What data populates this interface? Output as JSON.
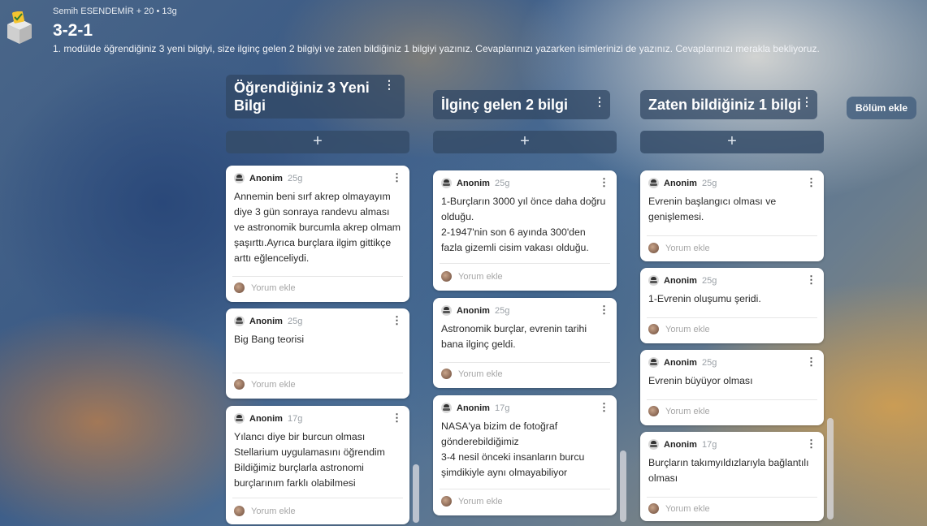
{
  "header": {
    "meta": "Semih ESENDEMİR + 20 • 13g",
    "title": "3-2-1",
    "description": "1. modülde öğrendiğiniz 3 yeni bilgiyi, size ilginç gelen 2 bilgiyi ve zaten bildiğiniz 1 bilgiyi yazınız. Cevaplarınızı yazarken isimlerinizi de yazınız. Cevaplarınızı merakla bekliyoruz."
  },
  "add_symbol": "+",
  "menu_symbol": "⋮",
  "add_section_label": "Bölüm ekle",
  "icons": {
    "app": "ballot-box-icon",
    "author": "anonymous-spy-icon",
    "avatar": "user-avatar-icon",
    "menu": "vertical-ellipsis-icon",
    "add": "plus-icon"
  },
  "columns": [
    {
      "title": "Öğrendiğiniz 3 Yeni Bilgi",
      "posts": [
        {
          "author": "Anonim",
          "time": "25g",
          "body": "Annemin beni sırf akrep olmayayım diye 3 gün sonraya randevu alması ve astronomik burcumla akrep olmam şaşırttı.Ayrıca burçlara ilgim gittikçe arttı eğlenceliydi.",
          "comment": "Yorum ekle"
        },
        {
          "author": "Anonim",
          "time": "25g",
          "body": "Big Bang teorisi",
          "comment": "Yorum ekle"
        },
        {
          "author": "Anonim",
          "time": "17g",
          "body": "Yılancı diye bir burcun olması\nStellarium uygulamasını öğrendim\nBildiğimiz burçlarla astronomi burçlarınım farklı olabilmesi",
          "comment": "Yorum ekle"
        }
      ]
    },
    {
      "title": "İlginç gelen 2 bilgi",
      "posts": [
        {
          "author": "Anonim",
          "time": "25g",
          "body": "1-Burçların 3000 yıl önce daha doğru olduğu.\n2-1947'nin son 6 ayında 300'den fazla gizemli cisim vakası olduğu.",
          "comment": "Yorum ekle"
        },
        {
          "author": "Anonim",
          "time": "25g",
          "body": "Astronomik burçlar, evrenin tarihi bana ilginç geldi.",
          "comment": "Yorum ekle"
        },
        {
          "author": "Anonim",
          "time": "17g",
          "body": "NASA'ya bizim de fotoğraf gönderebildiğimiz\n3-4 nesil önceki insanların burcu şimdikiyle aynı olmayabiliyor",
          "comment": "Yorum ekle"
        }
      ]
    },
    {
      "title": "Zaten bildiğiniz 1 bilgi",
      "posts": [
        {
          "author": "Anonim",
          "time": "25g",
          "body": "Evrenin başlangıcı olması ve genişlemesi.",
          "comment": "Yorum ekle"
        },
        {
          "author": "Anonim",
          "time": "25g",
          "body": "1-Evrenin oluşumu şeridi.",
          "comment": "Yorum ekle"
        },
        {
          "author": "Anonim",
          "time": "25g",
          "body": "Evrenin büyüyor olması",
          "comment": "Yorum ekle"
        },
        {
          "author": "Anonim",
          "time": "17g",
          "body": "Burçların takımyıldızlarıyla bağlantılı olması",
          "comment": "Yorum ekle"
        }
      ]
    }
  ]
}
